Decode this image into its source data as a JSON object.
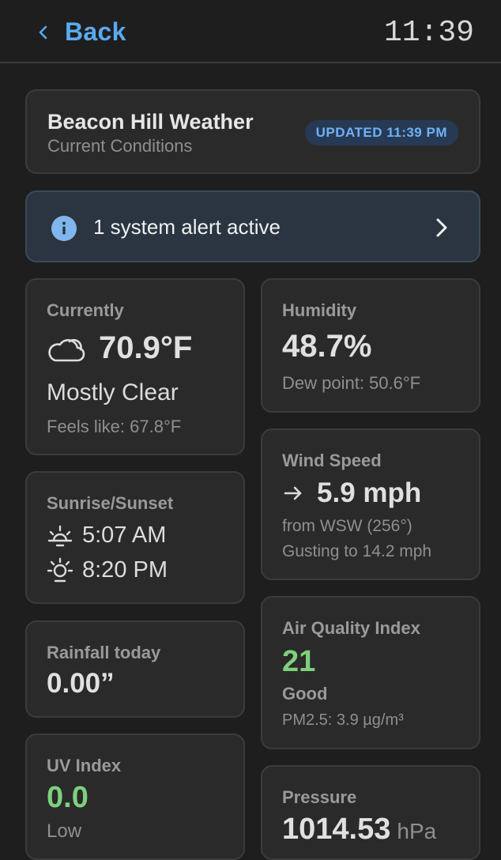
{
  "nav": {
    "back_label": "Back",
    "clock": "11:39"
  },
  "header": {
    "station_name": "Beacon Hill Weather",
    "subtitle": "Current Conditions",
    "updated_badge": "UPDATED 11:39 PM"
  },
  "alert": {
    "text": "1 system alert active",
    "icon": "info-icon"
  },
  "current": {
    "title": "Currently",
    "temperature": "70.9°F",
    "condition": "Mostly Clear",
    "feels_like": "Feels like: 67.8°F",
    "icon": "cloud-icon"
  },
  "sun": {
    "title": "Sunrise/Sunset",
    "sunrise": "5:07 AM",
    "sunset": "8:20 PM"
  },
  "rainfall": {
    "title": "Rainfall today",
    "value": "0.00”"
  },
  "uv": {
    "title": "UV Index",
    "value": "0.0",
    "level": "Low",
    "color": "#7ed07e"
  },
  "humidity": {
    "title": "Humidity",
    "value": "48.7%",
    "dew_point": "Dew point: 50.6°F"
  },
  "wind": {
    "title": "Wind Speed",
    "speed": "5.9 mph",
    "from": "from WSW (256°)",
    "gust": "Gusting to 14.2 mph"
  },
  "aqi": {
    "title": "Air Quality Index",
    "value": "21",
    "level": "Good",
    "pm25": "PM2.5: 3.9 µg/m³",
    "color": "#7ed07e"
  },
  "pressure": {
    "title": "Pressure",
    "value": "1014.53",
    "unit": "hPa"
  },
  "colors": {
    "accent": "#5aaaf0",
    "good": "#7ed07e",
    "background": "#1e1e1e",
    "card": "#2a2a2a"
  }
}
